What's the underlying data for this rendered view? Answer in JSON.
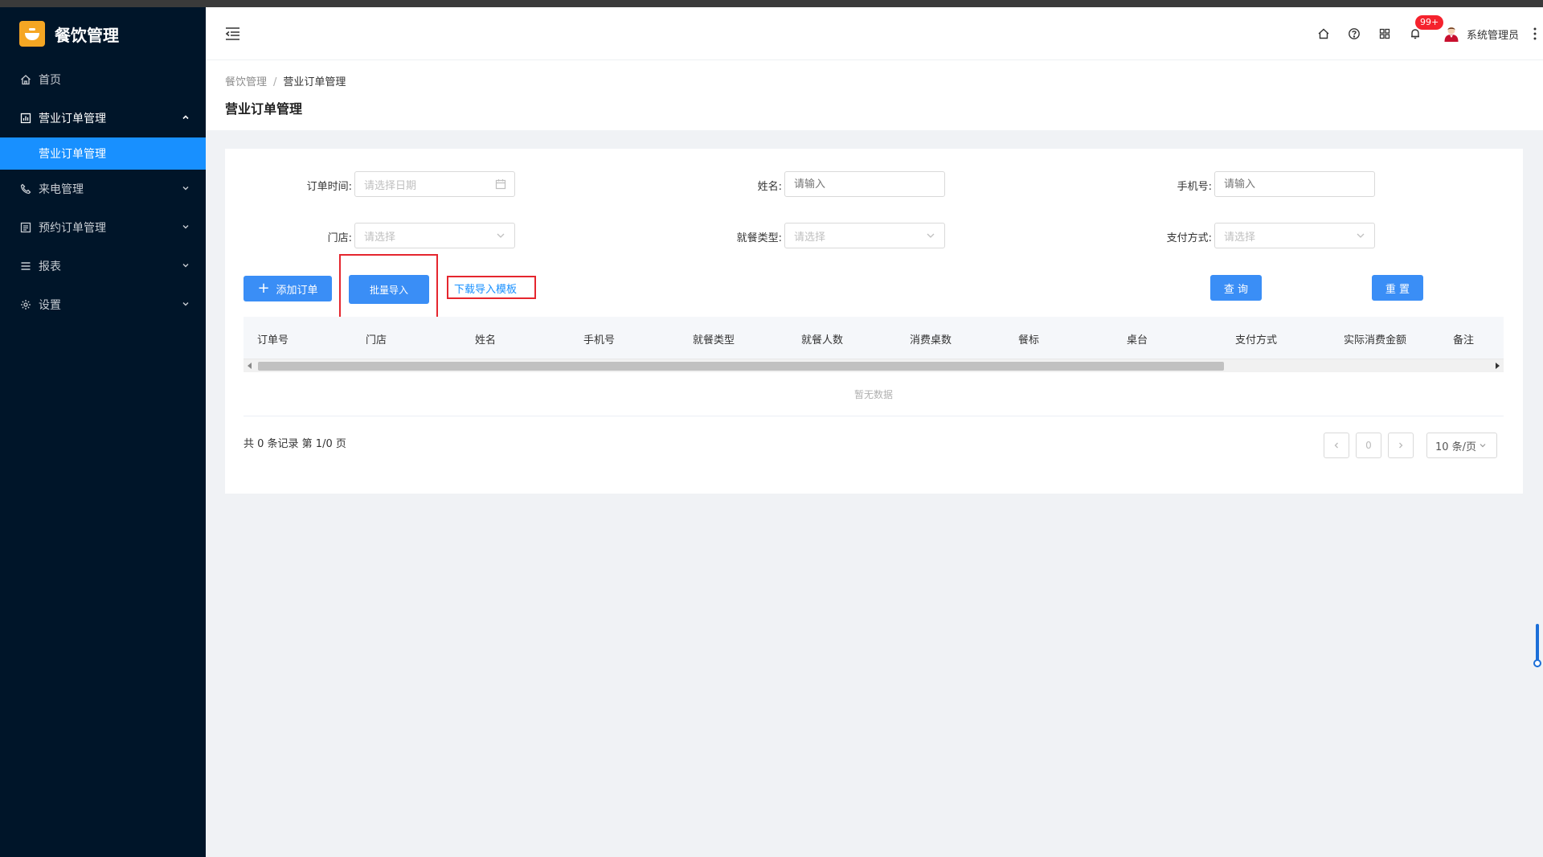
{
  "app": {
    "title": "餐饮管理"
  },
  "sidebar": {
    "items": [
      {
        "label": "首页",
        "icon": "home-icon"
      },
      {
        "label": "营业订单管理",
        "icon": "chart-icon",
        "open": true,
        "children": [
          {
            "label": "营业订单管理",
            "active": true
          }
        ]
      },
      {
        "label": "来电管理",
        "icon": "phone-icon"
      },
      {
        "label": "预约订单管理",
        "icon": "list-icon"
      },
      {
        "label": "报表",
        "icon": "menu-icon"
      },
      {
        "label": "设置",
        "icon": "gear-icon"
      }
    ]
  },
  "header": {
    "notification_count": "99+",
    "user_name": "系统管理员"
  },
  "breadcrumb": {
    "root": "餐饮管理",
    "separator": "/",
    "current": "营业订单管理"
  },
  "page": {
    "title": "营业订单管理"
  },
  "filters": {
    "order_time": {
      "label": "订单时间:",
      "placeholder": "请选择日期"
    },
    "name": {
      "label": "姓名:",
      "placeholder": "请输入"
    },
    "phone": {
      "label": "手机号:",
      "placeholder": "请输入"
    },
    "store": {
      "label": "门店:",
      "placeholder": "请选择"
    },
    "dining_type": {
      "label": "就餐类型:",
      "placeholder": "请选择"
    },
    "payment": {
      "label": "支付方式:",
      "placeholder": "请选择"
    }
  },
  "actions": {
    "add_order": "添加订单",
    "batch_import": "批量导入",
    "download_template": "下载导入模板",
    "query": "查 询",
    "reset": "重 置"
  },
  "table": {
    "columns": [
      "订单号",
      "门店",
      "姓名",
      "手机号",
      "就餐类型",
      "就餐人数",
      "消费桌数",
      "餐标",
      "桌台",
      "支付方式",
      "实际消费金额",
      "备注"
    ],
    "empty_text": "暂无数据"
  },
  "pagination": {
    "summary": "共 0 条记录 第 1/0 页",
    "current_page": "0",
    "page_size": "10 条/页"
  },
  "colors": {
    "sidebar_bg": "#001529",
    "primary": "#1890ff",
    "highlight_box": "#e5262e",
    "logo": "#f5a623"
  }
}
